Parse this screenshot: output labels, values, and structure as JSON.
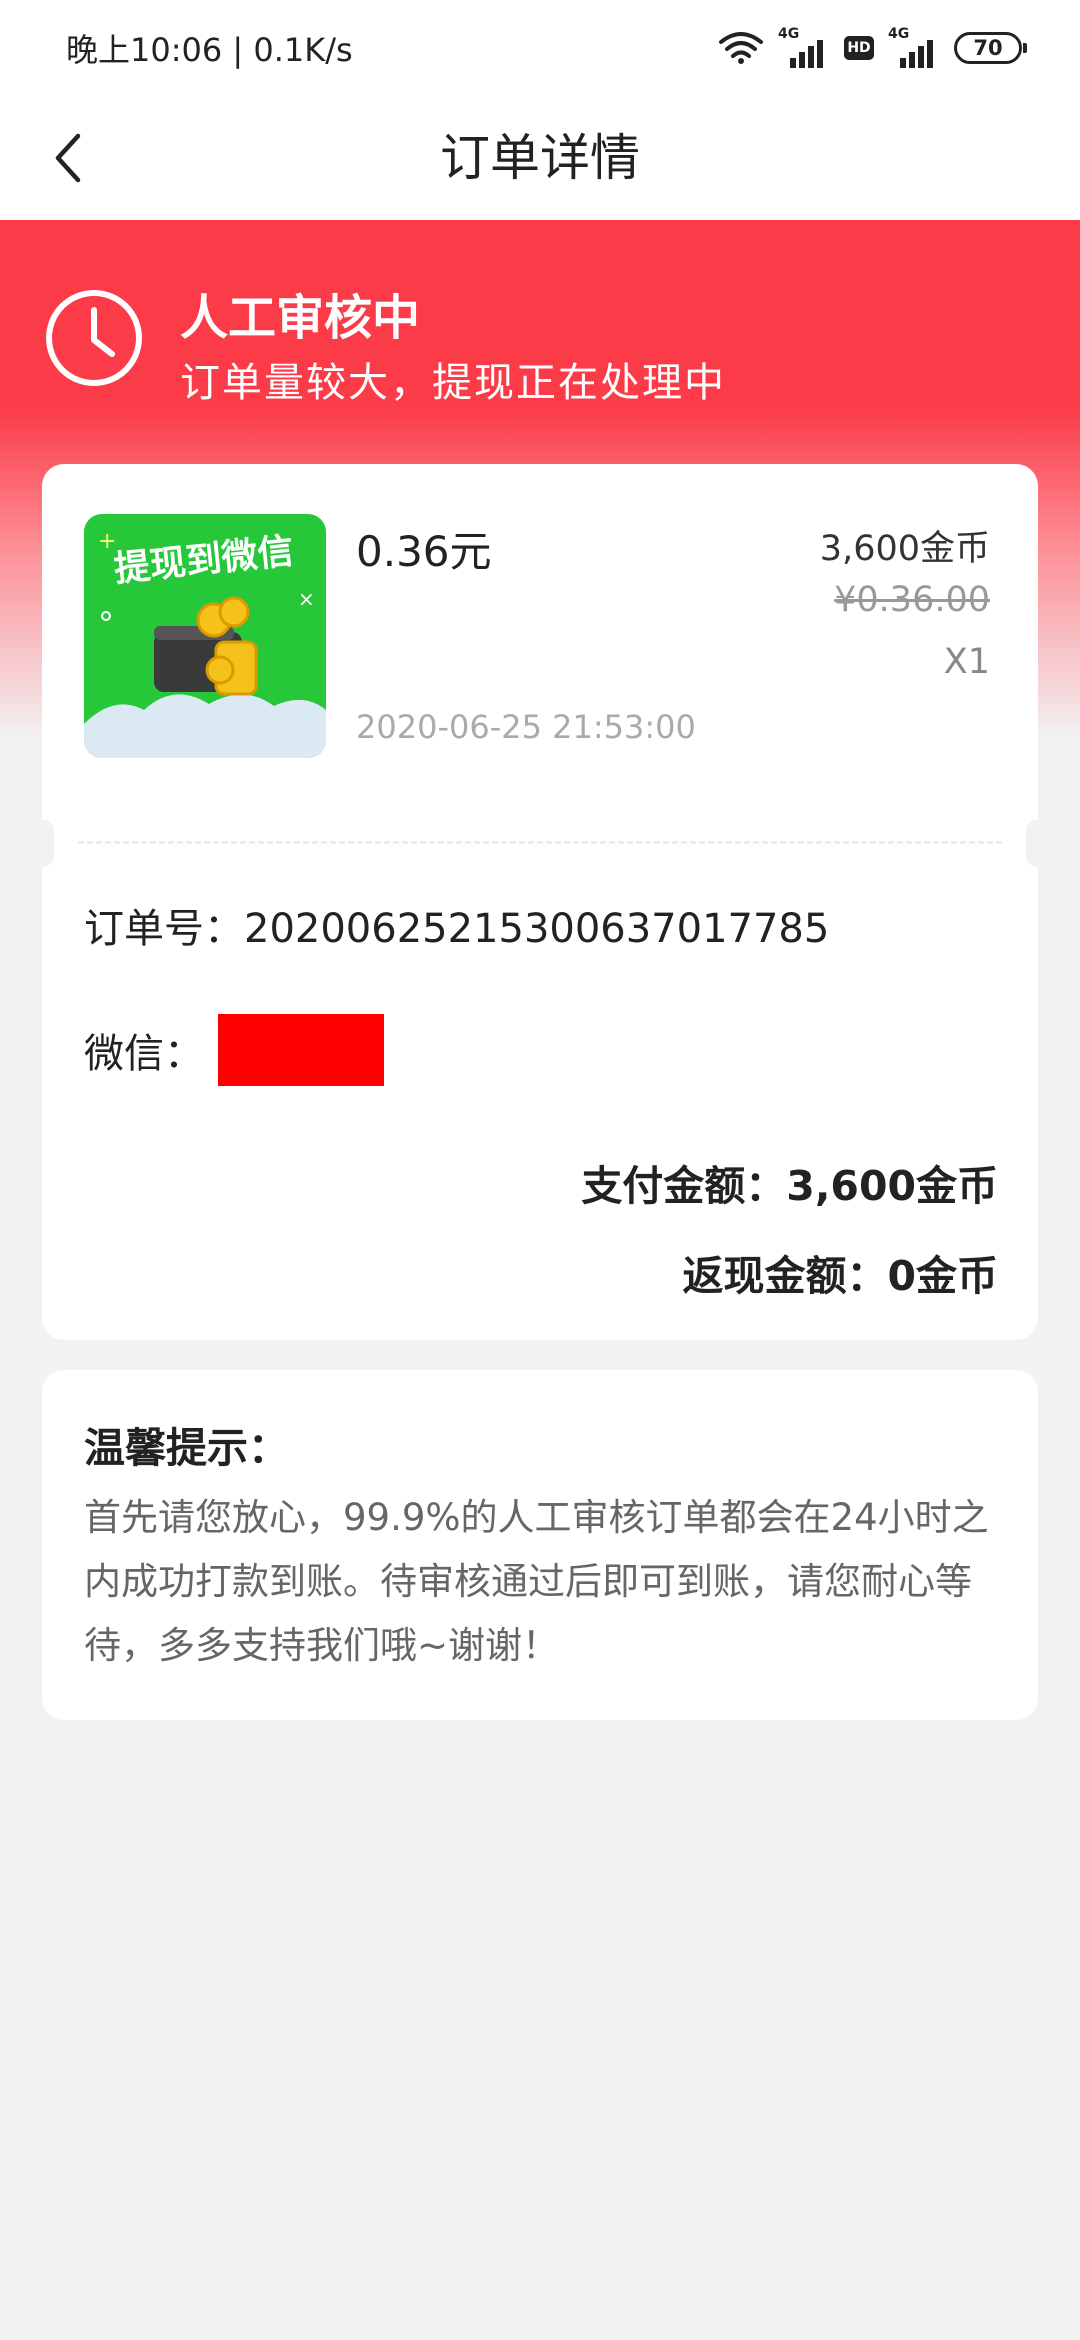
{
  "status_bar": {
    "time_speed": "晚上10:06 | 0.1K/s",
    "network1": "4G",
    "network2": "4G",
    "hd": "HD",
    "battery": "70",
    "icons": [
      "wifi-icon",
      "signal-icon",
      "hd-icon",
      "signal-icon",
      "battery-icon"
    ]
  },
  "nav": {
    "title": "订单详情",
    "back_icon": "chevron-left-icon"
  },
  "status": {
    "icon": "clock-icon",
    "title": "人工审核中",
    "subtitle": "订单量较大，提现正在处理中"
  },
  "product": {
    "thumb_text": "提现到微信",
    "name": "0.36元",
    "coin_price": "3,600金币",
    "original_price": "¥0.36.00",
    "quantity": "X1",
    "time": "2020-06-25  21:53:00"
  },
  "order": {
    "order_no": "订单号：2020062521530063701778​5",
    "wechat_label": "微信：",
    "pay_amount": "支付金额：3,600金币",
    "cashback_amount": "返现金额：0金币"
  },
  "tips": {
    "title": "温馨提示：",
    "body": "首先请您放心，99.9%的人工审核订单都会在24小时之内成功打款到账。待审核通过后即可到账，请您耐心等待，多多支持我们哦~谢谢！"
  },
  "colors": {
    "accent_red": "#fb3b48",
    "page_bg": "#f2f2f2",
    "thumb_green": "#27c73a"
  }
}
